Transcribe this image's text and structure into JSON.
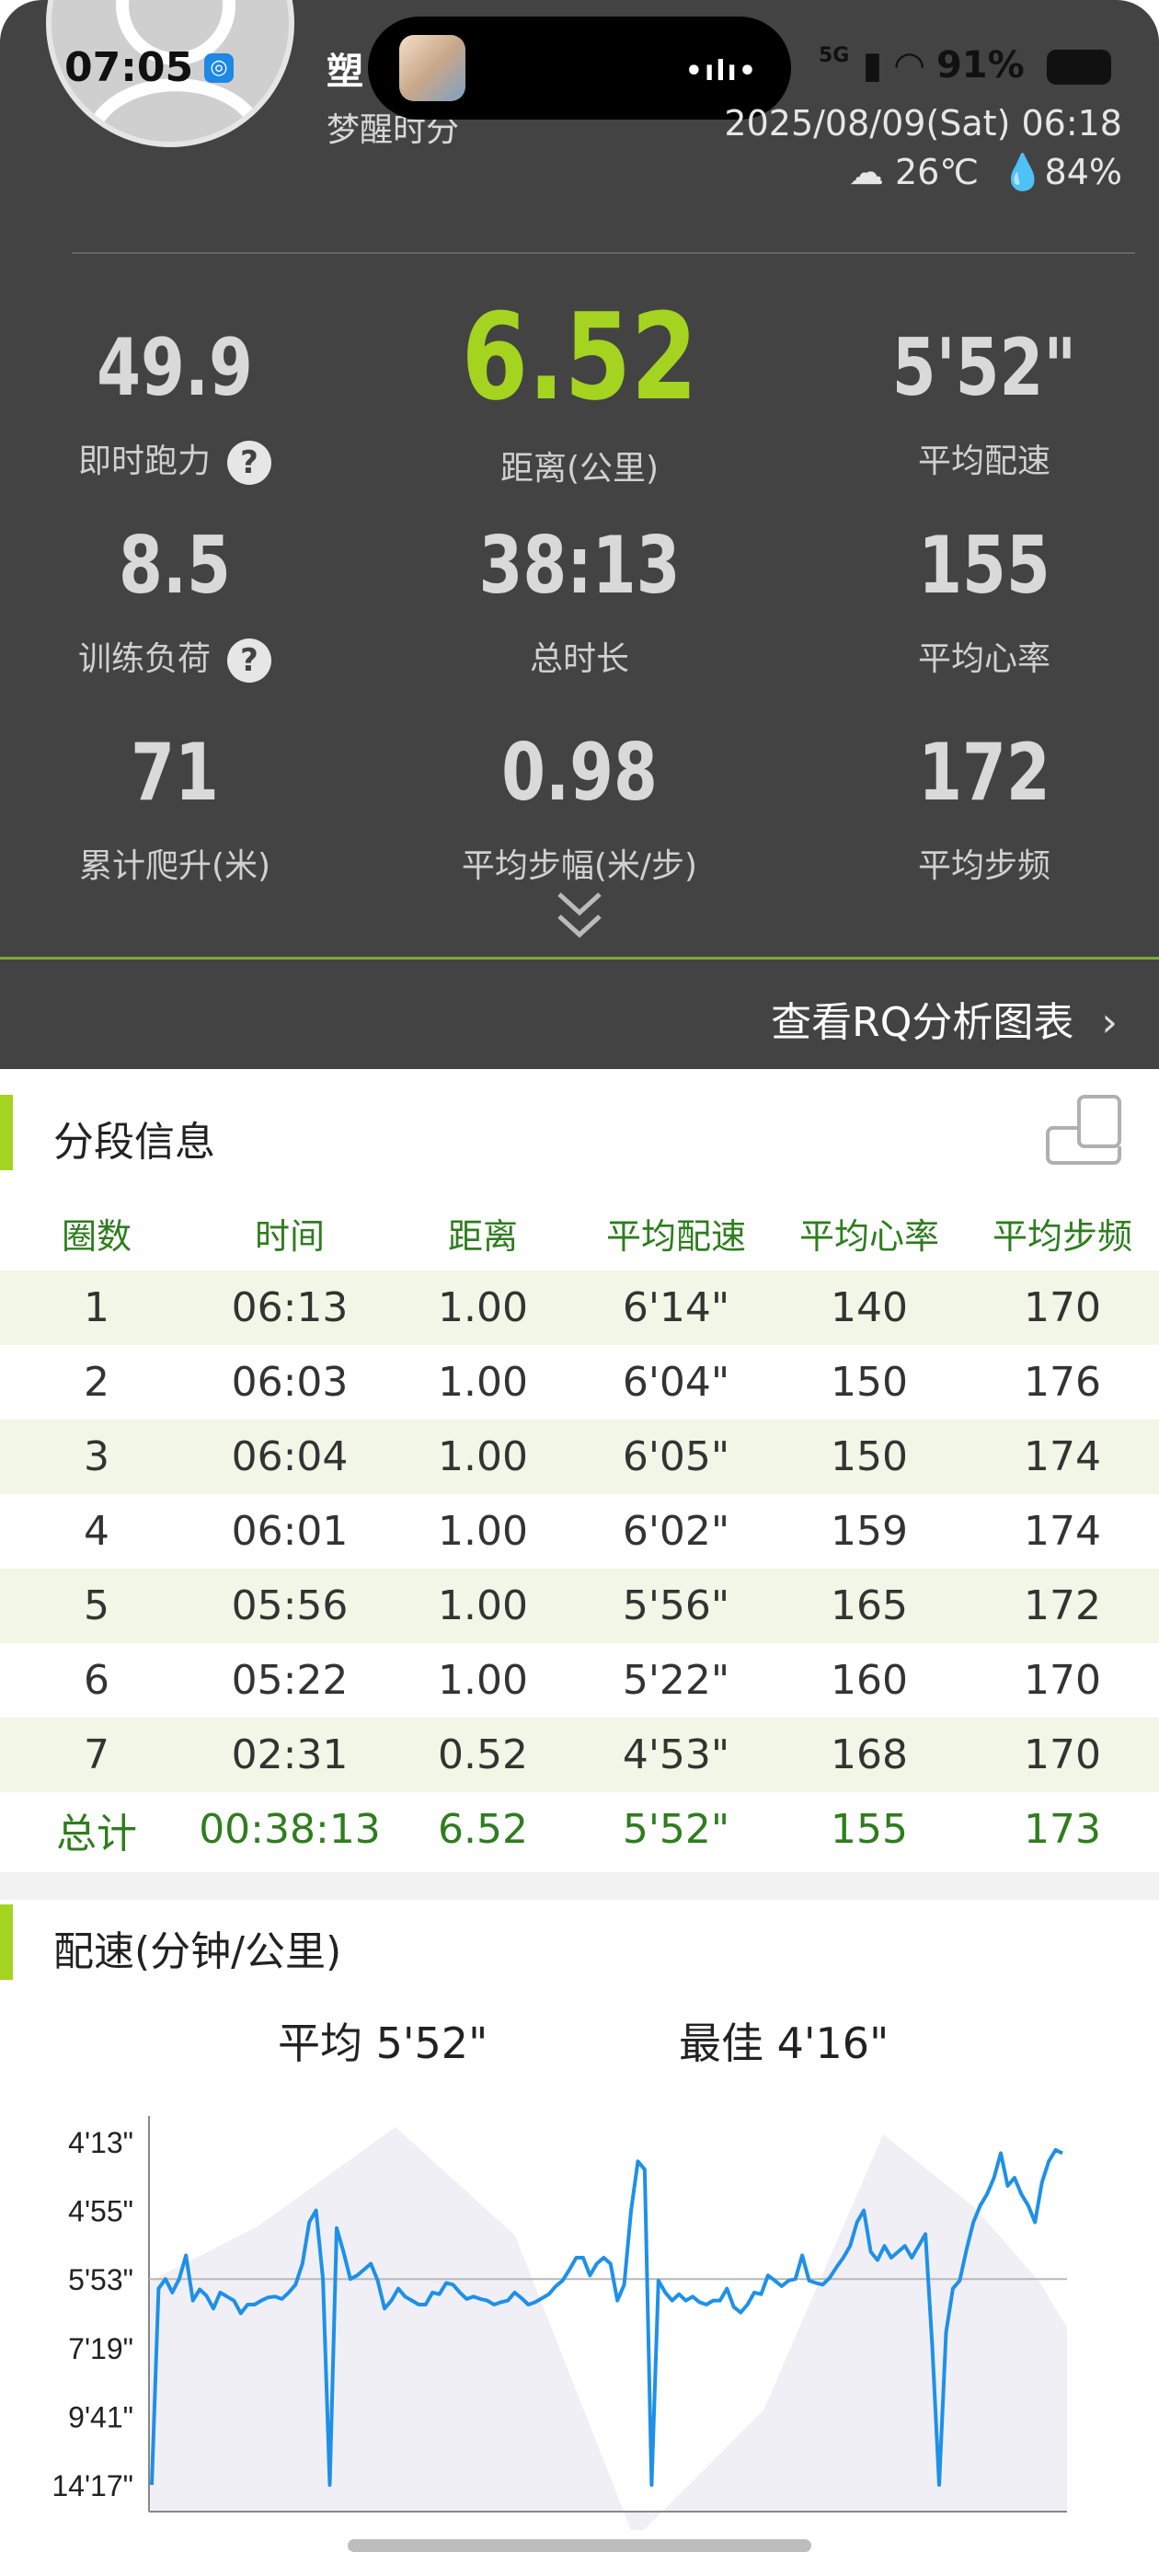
{
  "status_bar": {
    "time": "07:05",
    "network": "5G",
    "battery": "91%"
  },
  "user": {
    "name": "塑",
    "subtitle": "梦醒时分"
  },
  "session": {
    "datetime": "2025/08/09(Sat) 06:18",
    "temperature": "26℃",
    "humidity": "84%"
  },
  "stats": [
    {
      "value": "49.9",
      "label": "即时跑力",
      "help": "?"
    },
    {
      "value": "6.52",
      "label": "距离(公里)"
    },
    {
      "value": "5'52\"",
      "label": "平均配速"
    },
    {
      "value": "8.5",
      "label": "训练负荷",
      "help": "?"
    },
    {
      "value": "38:13",
      "label": "总时长"
    },
    {
      "value": "155",
      "label": "平均心率"
    },
    {
      "value": "71",
      "label": "累计爬升(米)"
    },
    {
      "value": "0.98",
      "label": "平均步幅(米/步)"
    },
    {
      "value": "172",
      "label": "平均步频"
    }
  ],
  "rq_link": {
    "label": "查看RQ分析图表",
    "chevron": "›"
  },
  "splits": {
    "title": "分段信息",
    "headers": [
      "圈数",
      "时间",
      "距离",
      "平均配速",
      "平均心率",
      "平均步频"
    ],
    "rows": [
      [
        "1",
        "06:13",
        "1.00",
        "6'14\"",
        "140",
        "170"
      ],
      [
        "2",
        "06:03",
        "1.00",
        "6'04\"",
        "150",
        "176"
      ],
      [
        "3",
        "06:04",
        "1.00",
        "6'05\"",
        "150",
        "174"
      ],
      [
        "4",
        "06:01",
        "1.00",
        "6'02\"",
        "159",
        "174"
      ],
      [
        "5",
        "05:56",
        "1.00",
        "5'56\"",
        "165",
        "172"
      ],
      [
        "6",
        "05:22",
        "1.00",
        "5'22\"",
        "160",
        "170"
      ],
      [
        "7",
        "02:31",
        "0.52",
        "4'53\"",
        "168",
        "170"
      ]
    ],
    "total": [
      "总计",
      "00:38:13",
      "6.52",
      "5'52\"",
      "155",
      "173"
    ]
  },
  "pace": {
    "title": "配速(分钟/公里)",
    "average": "平均 5'52\"",
    "best": "最佳 4'16\""
  },
  "chart_data": {
    "type": "line",
    "title": "",
    "ylabel": "",
    "y_ticks": [
      "4'13\"",
      "4'55\"",
      "5'53\"",
      "7'19\"",
      "9'41\"",
      "14'17\""
    ],
    "average_line": "5'53\"",
    "line_color": "#1e90e8",
    "elevation_fill": "#f0eff5",
    "series": [
      {
        "values": [
          "14'17\"",
          "6'05\"",
          "5'53\"",
          "6'10\"",
          "5'53\"",
          "5'33\"",
          "6'20\"",
          "6'06\"",
          "6'14\"",
          "6'30\"",
          "6'10\"",
          "6'15\"",
          "6'20\"",
          "6'36\"",
          "6'25\"",
          "6'25\"",
          "6'20\"",
          "6'16\"",
          "6'15\"",
          "6'18\"",
          "6'10\"",
          "6'00\"",
          "5'40\"",
          "5'05\"",
          "4'55\"",
          "5'53\"",
          "14'17\"",
          "5'10\"",
          "5'30\"",
          "5'53\"",
          "5'50\"",
          "5'45\"",
          "5'40\"",
          "5'55\"",
          "6'30\"",
          "6'20\"",
          "6'05\"",
          "6'15\"",
          "6'20\"",
          "6'25\"",
          "6'25\"",
          "6'10\"",
          "6'12\"",
          "5'58\"",
          "6'00\"",
          "6'10\"",
          "6'18\"",
          "6'15\"",
          "6'18\"",
          "6'20\"",
          "6'25\"",
          "6'22\"",
          "6'20\"",
          "6'10\"",
          "6'17\"",
          "6'25\"",
          "6'22\"",
          "6'17\"",
          "6'12\"",
          "6'02\"",
          "5'55\"",
          "5'45\"",
          "5'35\"",
          "5'35\"",
          "5'50\"",
          "5'40\"",
          "5'35\"",
          "5'40\"",
          "6'20\"",
          "6'00\"",
          "4'55\"",
          "4'25\"",
          "4'30\"",
          "14'17\"",
          "5'55\"",
          "6'10\"",
          "6'20\"",
          "6'12\"",
          "6'20\"",
          "6'15\"",
          "6'22\"",
          "6'25\"",
          "6'20\"",
          "6'20\"",
          "6'05\"",
          "6'28\"",
          "6'35\"",
          "6'25\"",
          "6'10\"",
          "6'12\"",
          "5'50\"",
          "5'55\"",
          "6'02\"",
          "5'55\"",
          "5'53\"",
          "5'33\"",
          "5'55\"",
          "5'58\"",
          "6'00\"",
          "5'52\"",
          "5'43\"",
          "5'35\"",
          "5'25\"",
          "5'05\"",
          "4'55\"",
          "5'30\"",
          "5'37\"",
          "5'25\"",
          "5'35\"",
          "5'30\"",
          "5'25\"",
          "5'35\"",
          "5'25\"",
          "5'15\"",
          "7'19\"",
          "14'17\"",
          "7'00\"",
          "6'05\"",
          "5'55\"",
          "5'28\"",
          "5'05\"",
          "4'52\"",
          "4'45\"",
          "4'35\"",
          "4'20\"",
          "4'40\"",
          "4'35\"",
          "4'45\"",
          "4'52\"",
          "5'05\"",
          "4'38\"",
          "4'25\"",
          "4'18\"",
          "4'20\""
        ]
      }
    ]
  }
}
